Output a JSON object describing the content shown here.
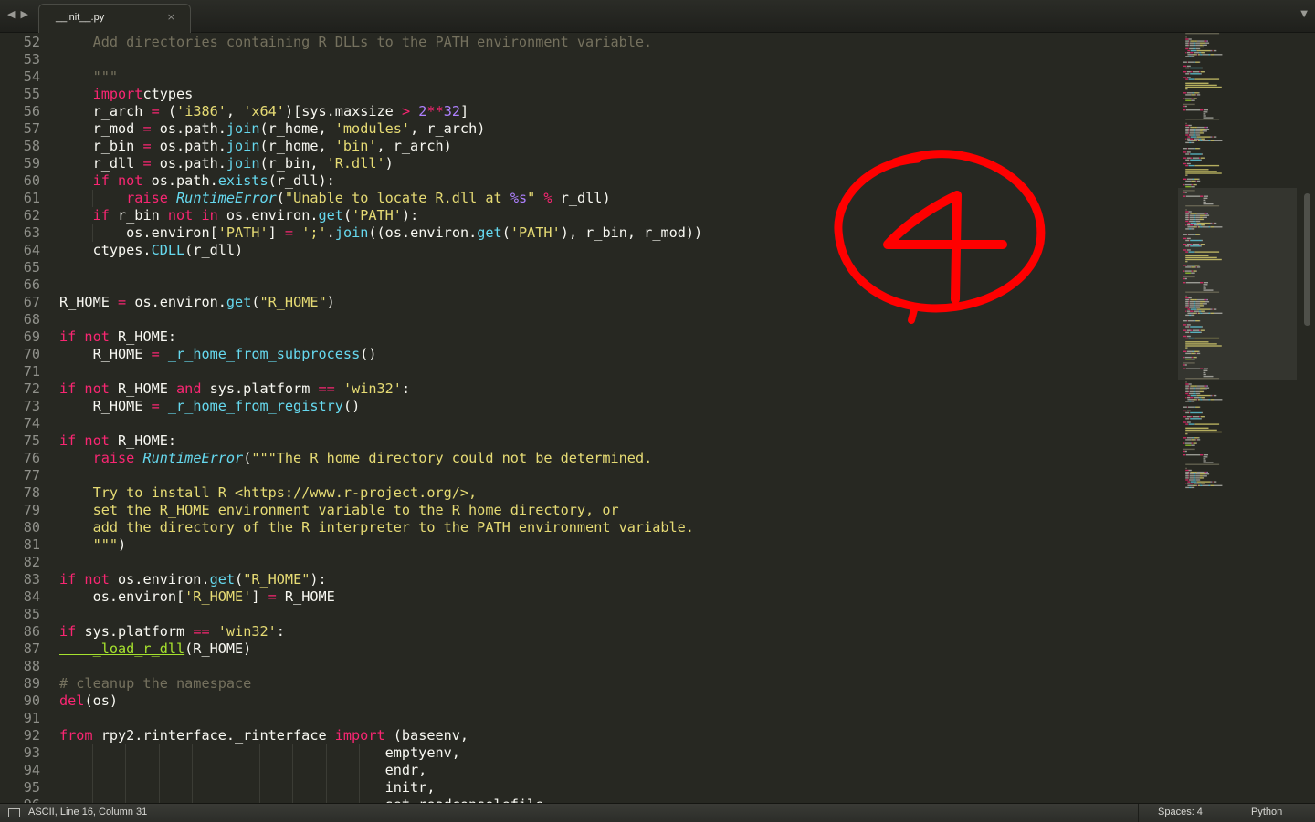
{
  "tab": {
    "filename": "__init__.py",
    "close_glyph": "×"
  },
  "nav": {
    "back": "◀",
    "forward": "▶",
    "menu": "▼"
  },
  "status": {
    "position": "ASCII, Line 16, Column 31",
    "indent": "Spaces: 4",
    "syntax": "Python"
  },
  "annotation": {
    "text": "4",
    "color": "#ff0000"
  },
  "theme": {
    "background": "#272822",
    "keyword": "#f92672",
    "string": "#e6db74",
    "builtin": "#66d9ef",
    "number": "#ae81ff",
    "comment": "#75715e",
    "function": "#a6e22e",
    "foreground": "#f8f8f2"
  },
  "editor": {
    "first_line_number": 52,
    "lines": [
      [
        [
          "cm",
          "    Add directories containing R DLLs to the PATH environment variable."
        ]
      ],
      [],
      [
        [
          "cm",
          "    \"\"\""
        ]
      ],
      [
        [
          "kw",
          "    import"
        ],
        [
          "",
          "ctypes"
        ]
      ],
      [
        [
          "",
          "    r_arch "
        ],
        [
          "kw",
          "="
        ],
        [
          "",
          " ("
        ],
        [
          "st",
          "'i386'"
        ],
        [
          "",
          ", "
        ],
        [
          "st",
          "'x64'"
        ],
        [
          "",
          ")[sys.maxsize "
        ],
        [
          "kw",
          ">"
        ],
        [
          "",
          " "
        ],
        [
          "nm",
          "2"
        ],
        [
          "kw",
          "**"
        ],
        [
          "nm",
          "32"
        ],
        [
          "",
          "]"
        ]
      ],
      [
        [
          "",
          "    r_mod "
        ],
        [
          "kw",
          "="
        ],
        [
          "",
          " os.path."
        ],
        [
          "fn",
          "join"
        ],
        [
          "",
          "(r_home, "
        ],
        [
          "st",
          "'modules'"
        ],
        [
          "",
          ", r_arch)"
        ]
      ],
      [
        [
          "",
          "    r_bin "
        ],
        [
          "kw",
          "="
        ],
        [
          "",
          " os.path."
        ],
        [
          "fn",
          "join"
        ],
        [
          "",
          "(r_home, "
        ],
        [
          "st",
          "'bin'"
        ],
        [
          "",
          ", r_arch)"
        ]
      ],
      [
        [
          "",
          "    r_dll "
        ],
        [
          "kw",
          "="
        ],
        [
          "",
          " os.path."
        ],
        [
          "fn",
          "join"
        ],
        [
          "",
          "(r_bin, "
        ],
        [
          "st",
          "'R.dll'"
        ],
        [
          "",
          ")"
        ]
      ],
      [
        [
          "kw",
          "    if not"
        ],
        [
          "",
          " os.path."
        ],
        [
          "fn",
          "exists"
        ],
        [
          "",
          "(r_dll):"
        ]
      ],
      [
        [
          "kw",
          "        raise"
        ],
        [
          "",
          " "
        ],
        [
          "ex",
          "RuntimeError"
        ],
        [
          "",
          "("
        ],
        [
          "st",
          "\"Unable to locate R.dll at "
        ],
        [
          "nm",
          "%s"
        ],
        [
          "st",
          "\""
        ],
        [
          "",
          " "
        ],
        [
          "kw",
          "%"
        ],
        [
          "",
          " r_dll)"
        ]
      ],
      [
        [
          "kw",
          "    if"
        ],
        [
          "",
          " r_bin "
        ],
        [
          "kw",
          "not in"
        ],
        [
          "",
          " os.environ."
        ],
        [
          "fn",
          "get"
        ],
        [
          "",
          "("
        ],
        [
          "st",
          "'PATH'"
        ],
        [
          "",
          "):"
        ]
      ],
      [
        [
          "",
          "        os.environ["
        ],
        [
          "st",
          "'PATH'"
        ],
        [
          "",
          "] "
        ],
        [
          "kw",
          "="
        ],
        [
          "",
          " "
        ],
        [
          "st",
          "';'"
        ],
        [
          "",
          "."
        ],
        [
          "fn",
          "join"
        ],
        [
          "",
          "((os.environ."
        ],
        [
          "fn",
          "get"
        ],
        [
          "",
          "("
        ],
        [
          "st",
          "'PATH'"
        ],
        [
          "",
          "), r_bin, r_mod))"
        ]
      ],
      [
        [
          "",
          "    ctypes."
        ],
        [
          "fn",
          "CDLL"
        ],
        [
          "",
          "(r_dll)"
        ]
      ],
      [],
      [],
      [
        [
          "",
          "R_HOME "
        ],
        [
          "kw",
          "="
        ],
        [
          "",
          " os.environ."
        ],
        [
          "fn",
          "get"
        ],
        [
          "",
          "("
        ],
        [
          "st",
          "\"R_HOME\""
        ],
        [
          "",
          ")"
        ]
      ],
      [],
      [
        [
          "kw",
          "if not"
        ],
        [
          "",
          " R_HOME:"
        ]
      ],
      [
        [
          "",
          "    R_HOME "
        ],
        [
          "kw",
          "="
        ],
        [
          "",
          " "
        ],
        [
          "fn",
          "_r_home_from_subprocess"
        ],
        [
          "",
          "()"
        ]
      ],
      [],
      [
        [
          "kw",
          "if not"
        ],
        [
          "",
          " R_HOME "
        ],
        [
          "kw",
          "and"
        ],
        [
          "",
          " sys.platform "
        ],
        [
          "kw",
          "=="
        ],
        [
          "",
          " "
        ],
        [
          "st",
          "'win32'"
        ],
        [
          "",
          ":"
        ]
      ],
      [
        [
          "",
          "    R_HOME "
        ],
        [
          "kw",
          "="
        ],
        [
          "",
          " "
        ],
        [
          "fn",
          "_r_home_from_registry"
        ],
        [
          "",
          "()"
        ]
      ],
      [],
      [
        [
          "kw",
          "if not"
        ],
        [
          "",
          " R_HOME:"
        ]
      ],
      [
        [
          "kw",
          "    raise"
        ],
        [
          "",
          " "
        ],
        [
          "ex",
          "RuntimeError"
        ],
        [
          "",
          "("
        ],
        [
          "st",
          "\"\"\"The R home directory could not be determined."
        ]
      ],
      [],
      [
        [
          "st",
          "    Try to install R <https://www.r-project.org/>,"
        ]
      ],
      [
        [
          "st",
          "    set the R_HOME environment variable to the R home directory, or"
        ]
      ],
      [
        [
          "st",
          "    add the directory of the R interpreter to the PATH environment variable."
        ]
      ],
      [
        [
          "st",
          "    \"\"\""
        ],
        [
          "",
          ")"
        ]
      ],
      [],
      [
        [
          "kw",
          "if not"
        ],
        [
          "",
          " os.environ."
        ],
        [
          "fn",
          "get"
        ],
        [
          "",
          "("
        ],
        [
          "st",
          "\"R_HOME\""
        ],
        [
          "",
          "):"
        ]
      ],
      [
        [
          "",
          "    os.environ["
        ],
        [
          "st",
          "'R_HOME'"
        ],
        [
          "",
          "] "
        ],
        [
          "kw",
          "="
        ],
        [
          "",
          " R_HOME"
        ]
      ],
      [],
      [
        [
          "kw",
          "if"
        ],
        [
          "",
          " sys.platform "
        ],
        [
          "kw",
          "=="
        ],
        [
          "",
          " "
        ],
        [
          "st",
          "'win32'"
        ],
        [
          "",
          ":"
        ]
      ],
      [
        [
          "du",
          "    _load_r_dll"
        ],
        [
          "",
          "(R_HOME)"
        ]
      ],
      [],
      [
        [
          "cm",
          "# cleanup the namespace"
        ]
      ],
      [
        [
          "kw",
          "del"
        ],
        [
          "",
          "(os)"
        ]
      ],
      [],
      [
        [
          "kw",
          "from"
        ],
        [
          "",
          " rpy2.rinterface._rinterface "
        ],
        [
          "kw",
          "import"
        ],
        [
          "",
          " (baseenv,"
        ]
      ],
      [
        [
          "",
          "                                       emptyenv,"
        ]
      ],
      [
        [
          "",
          "                                       endr,"
        ]
      ],
      [
        [
          "",
          "                                       initr,"
        ]
      ],
      [
        [
          "",
          "                                       set_readconsolefile,"
        ]
      ]
    ]
  }
}
